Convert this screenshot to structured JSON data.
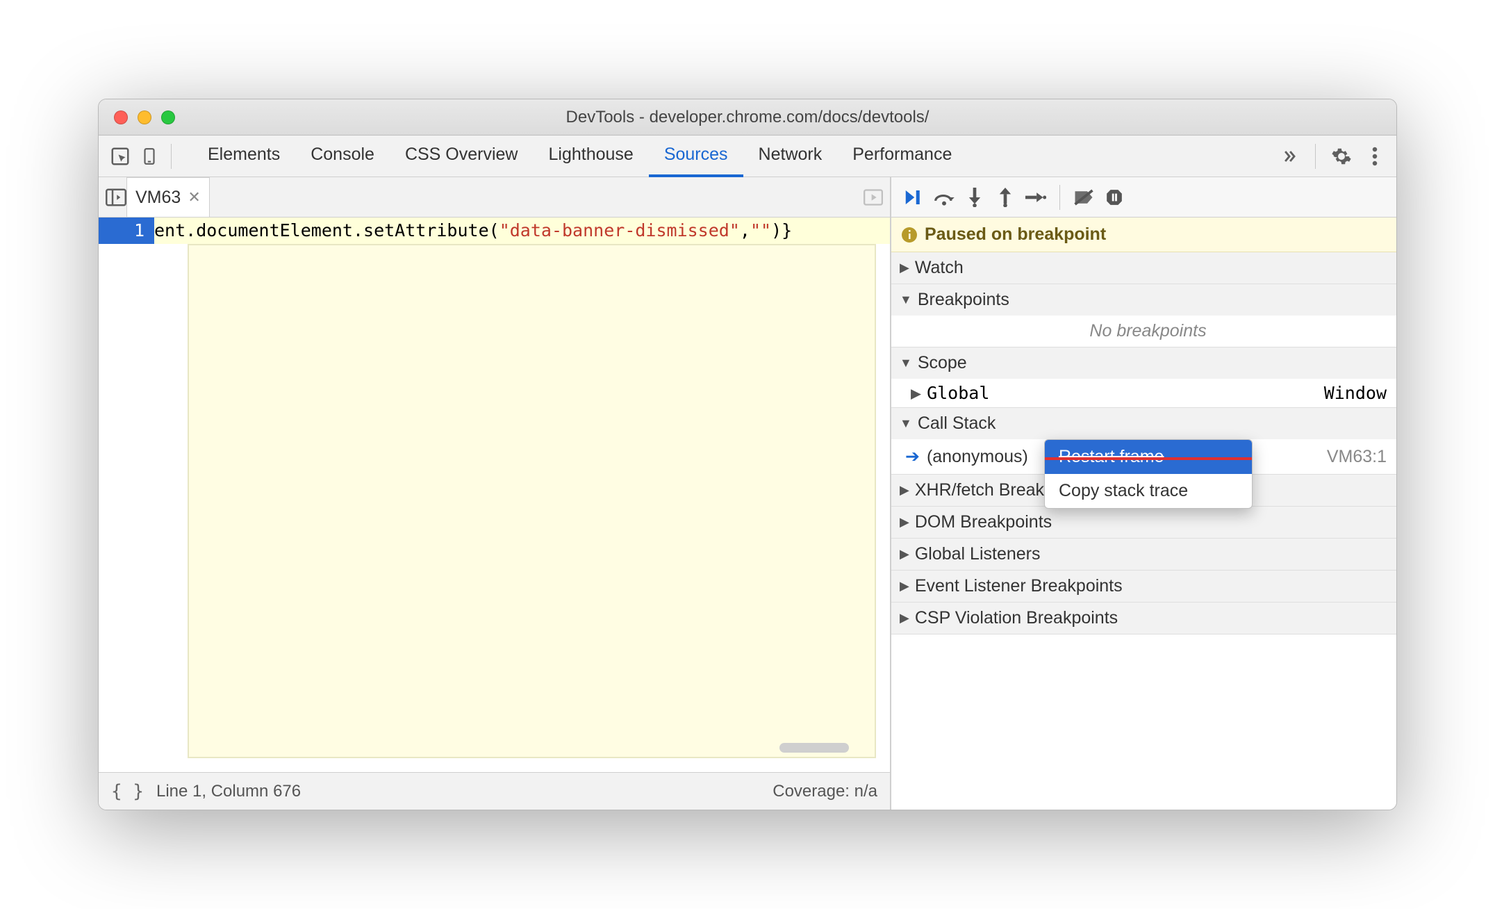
{
  "window": {
    "title": "DevTools - developer.chrome.com/docs/devtools/"
  },
  "toolbar": {
    "tabs": [
      "Elements",
      "Console",
      "CSS Overview",
      "Lighthouse",
      "Sources",
      "Network",
      "Performance"
    ],
    "active_tab": "Sources",
    "overflow_icon": "chevrons-right"
  },
  "file_tab": {
    "name": "VM63"
  },
  "code": {
    "line_number": "1",
    "prefix": "ent.documentElement.setAttribute(",
    "string": "\"data-banner-dismissed\"",
    "mid": ",",
    "string2": "\"\"",
    "suffix": ")}"
  },
  "status": {
    "position": "Line 1, Column 676",
    "coverage": "Coverage: n/a"
  },
  "paused": {
    "label": "Paused on breakpoint"
  },
  "panels": {
    "watch": "Watch",
    "breakpoints": "Breakpoints",
    "no_breakpoints": "No breakpoints",
    "scope": "Scope",
    "global": "Global",
    "global_value": "Window",
    "callstack": "Call Stack",
    "callstack_item": "(anonymous)",
    "callstack_loc": "VM63:1",
    "xhr": "XHR/fetch Breakp",
    "dom": "DOM Breakpoints",
    "listeners": "Global Listeners",
    "event_bp": "Event Listener Breakpoints",
    "csp": "CSP Violation Breakpoints"
  },
  "context_menu": {
    "restart": "Restart frame",
    "copy": "Copy stack trace"
  }
}
